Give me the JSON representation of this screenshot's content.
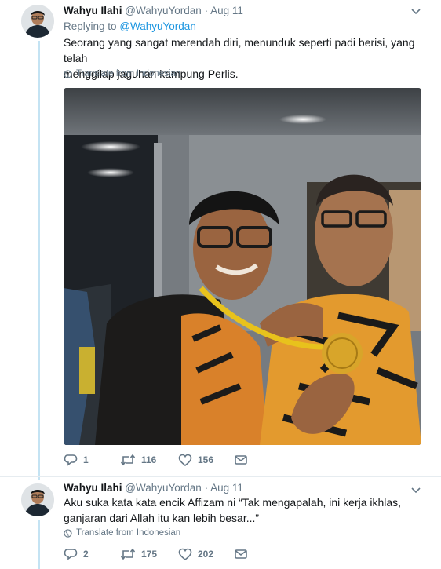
{
  "tweets": [
    {
      "author_name": "Wahyu Ilahi",
      "author_handle": "@WahyuYordan",
      "separator": "·",
      "date": "Aug 11",
      "reply_prefix": "Replying to",
      "reply_handle": "@WahyuYordan",
      "text_lines": [
        "Seorang yang sangat merendah diri, menunduk seperti padi berisi, yang telah",
        "menggilap jaguhan kampung Perlis."
      ],
      "translate_label": "Translate from Indonesian",
      "replies": "1",
      "retweets": "116",
      "likes": "156"
    },
    {
      "author_name": "Wahyu Ilahi",
      "author_handle": "@WahyuYordan",
      "separator": "·",
      "date": "Aug 11",
      "text_lines": [
        "Aku suka kata kata encik Affizam ni “Tak mengapalah, ini kerja ikhlas,",
        "ganjaran dari Allah itu kan lebih besar...”"
      ],
      "translate_label": "Translate from Indonesian",
      "replies": "2",
      "retweets": "175",
      "likes": "202"
    }
  ],
  "icons": {
    "globe": "globe-icon",
    "reply": "reply-icon",
    "retweet": "retweet-icon",
    "like": "heart-icon",
    "message": "envelope-icon",
    "caret": "chevron-down-icon"
  },
  "colors": {
    "link": "#1b95e0",
    "secondary": "#657786",
    "thread_line": "#c4e3f3"
  }
}
